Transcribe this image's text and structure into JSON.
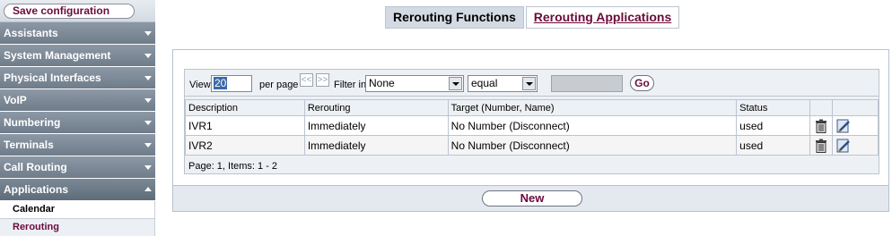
{
  "sidebar": {
    "save_label": "Save configuration",
    "items": [
      {
        "label": "Assistants",
        "expanded": false
      },
      {
        "label": "System Management",
        "expanded": false
      },
      {
        "label": "Physical Interfaces",
        "expanded": false
      },
      {
        "label": "VoIP",
        "expanded": false
      },
      {
        "label": "Numbering",
        "expanded": false
      },
      {
        "label": "Terminals",
        "expanded": false
      },
      {
        "label": "Call Routing",
        "expanded": false
      },
      {
        "label": "Applications",
        "expanded": true
      }
    ],
    "subitems": [
      {
        "label": "Calendar",
        "active": false
      },
      {
        "label": "Rerouting",
        "active": true
      }
    ]
  },
  "tabs": {
    "active": "Rerouting Functions",
    "link": "Rerouting Applications"
  },
  "filter": {
    "view_label": "View",
    "view_value": "20",
    "per_page_label": "per page",
    "prev_glyph": "<<",
    "next_glyph": ">>",
    "filter_in_label": "Filter in",
    "filter_field": "None",
    "filter_operator": "equal",
    "filter_value": "",
    "go_label": "Go"
  },
  "table": {
    "columns": [
      "Description",
      "Rerouting",
      "Target (Number, Name)",
      "Status",
      "",
      ""
    ],
    "rows": [
      {
        "description": "IVR1",
        "rerouting": "Immediately",
        "target": "No Number (Disconnect)",
        "status": "used"
      },
      {
        "description": "IVR2",
        "rerouting": "Immediately",
        "target": "No Number (Disconnect)",
        "status": "used"
      }
    ],
    "footer": "Page:  1, Items:  1 - 2"
  },
  "actions": {
    "new_label": "New"
  },
  "colors": {
    "accent": "#6b0a3c",
    "nav": "#7b8896",
    "panel_bg": "#edf1f5"
  }
}
